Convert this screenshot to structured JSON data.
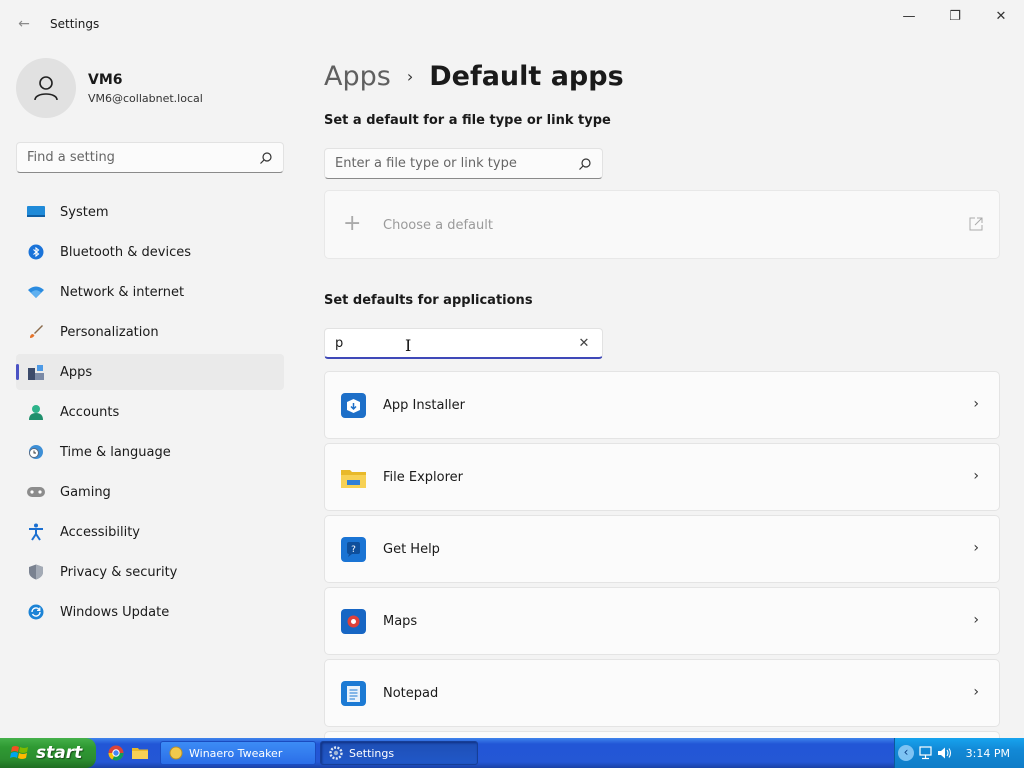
{
  "window": {
    "title": "Settings",
    "back": "←",
    "minimize": "—",
    "maximize": "❐",
    "close": "✕"
  },
  "profile": {
    "name": "VM6",
    "email": "VM6@collabnet.local"
  },
  "sidebar": {
    "search_placeholder": "Find a setting",
    "items": [
      {
        "label": "System",
        "icon": "monitor-icon"
      },
      {
        "label": "Bluetooth & devices",
        "icon": "bluetooth-icon"
      },
      {
        "label": "Network & internet",
        "icon": "wifi-icon"
      },
      {
        "label": "Personalization",
        "icon": "brush-icon"
      },
      {
        "label": "Apps",
        "icon": "apps-icon"
      },
      {
        "label": "Accounts",
        "icon": "person-icon"
      },
      {
        "label": "Time & language",
        "icon": "clock-globe-icon"
      },
      {
        "label": "Gaming",
        "icon": "gamepad-icon"
      },
      {
        "label": "Accessibility",
        "icon": "accessibility-icon"
      },
      {
        "label": "Privacy & security",
        "icon": "shield-icon"
      },
      {
        "label": "Windows Update",
        "icon": "update-icon"
      }
    ],
    "active_index": 4
  },
  "breadcrumb": {
    "parent": "Apps",
    "separator": "›",
    "current": "Default apps"
  },
  "file_type_section": {
    "heading": "Set a default for a file type or link type",
    "search_placeholder": "Enter a file type or link type",
    "choose_label": "Choose a default",
    "plus": "+"
  },
  "applications_section": {
    "heading": "Set defaults for applications",
    "search_value": "p",
    "clear": "✕",
    "apps": [
      {
        "name": "App Installer",
        "icon": "app-installer-icon"
      },
      {
        "name": "File Explorer",
        "icon": "folder-icon"
      },
      {
        "name": "Get Help",
        "icon": "help-icon"
      },
      {
        "name": "Maps",
        "icon": "maps-icon"
      },
      {
        "name": "Notepad",
        "icon": "notepad-icon"
      }
    ],
    "chevron": "›"
  },
  "taskbar": {
    "start_label": "start",
    "buttons": [
      {
        "label": "Winaero Tweaker",
        "active": false
      },
      {
        "label": "Settings",
        "active": true
      }
    ],
    "clock": "3:14 PM",
    "tray_expand": "‹"
  },
  "colors": {
    "accent": "#4a52c4",
    "taskbar_blue": "#2457d5",
    "start_green": "#2f9a33"
  }
}
